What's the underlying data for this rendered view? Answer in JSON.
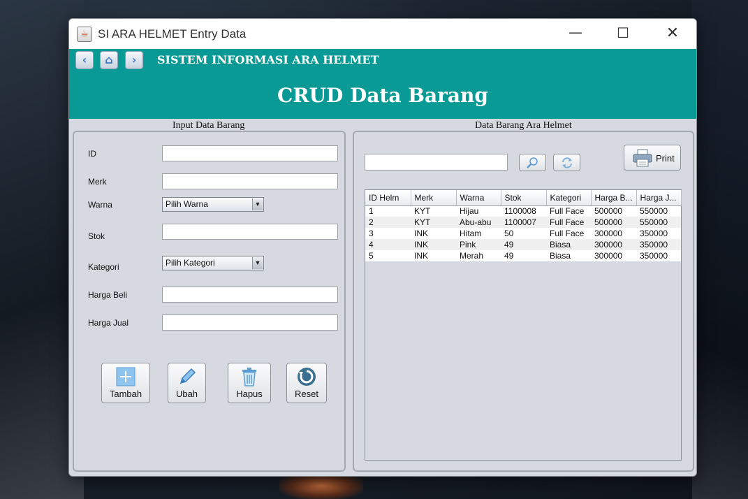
{
  "window": {
    "title": "SI ARA HELMET Entry Data",
    "controls": {
      "minimize": "—",
      "maximize": "☐",
      "close": "✕"
    }
  },
  "header": {
    "nav": {
      "back": "‹",
      "home": "⌂",
      "forward": "›"
    },
    "system_title": "SISTEM INFORMASI ARA HELMET",
    "page_title": "CRUD Data Barang",
    "background_color": "#0a9a95"
  },
  "form": {
    "section_title": "Input Data Barang",
    "fields": {
      "id": {
        "label": "ID",
        "value": ""
      },
      "merk": {
        "label": "Merk",
        "value": ""
      },
      "warna": {
        "label": "Warna",
        "selected": "Pilih Warna"
      },
      "stok": {
        "label": "Stok",
        "value": ""
      },
      "kategori": {
        "label": "Kategori",
        "selected": "Pilih Kategori"
      },
      "harga_beli": {
        "label": "Harga Beli",
        "value": ""
      },
      "harga_jual": {
        "label": "Harga Jual",
        "value": ""
      }
    },
    "buttons": {
      "tambah": "Tambah",
      "ubah": "Ubah",
      "hapus": "Hapus",
      "reset": "Reset"
    },
    "icons": [
      "plus-icon",
      "pencil-icon",
      "trash-icon",
      "refresh-icon"
    ]
  },
  "table_panel": {
    "section_title": "Data Barang Ara Helmet",
    "search": {
      "value": ""
    },
    "print_label": "Print",
    "columns": [
      "ID Helm",
      "Merk",
      "Warna",
      "Stok",
      "Kategori",
      "Harga B...",
      "Harga J..."
    ],
    "rows": [
      [
        "1",
        "KYT",
        "Hijau",
        "1100008",
        "Full Face",
        "500000",
        "550000"
      ],
      [
        "2",
        "KYT",
        "Abu-abu",
        "1100007",
        "Full Face",
        "500000",
        "550000"
      ],
      [
        "3",
        "INK",
        "Hitam",
        "50",
        "Full Face",
        "300000",
        "350000"
      ],
      [
        "4",
        "INK",
        "Pink",
        "49",
        "Biasa",
        "300000",
        "350000"
      ],
      [
        "5",
        "INK",
        "Merah",
        "49",
        "Biasa",
        "300000",
        "350000"
      ]
    ]
  }
}
